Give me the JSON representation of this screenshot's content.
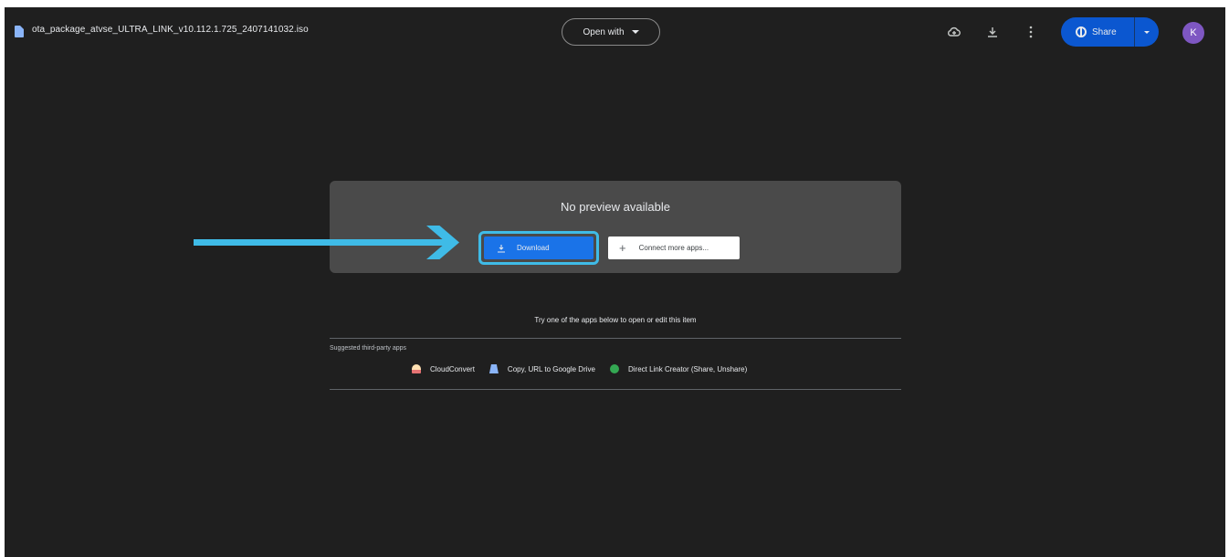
{
  "file": {
    "name": "ota_package_atvse_ULTRA_LINK_v10.112.1.725_2407141032.iso",
    "icon": "file-icon"
  },
  "toolbar": {
    "open_with_label": "Open with",
    "share_label": "Share",
    "avatar_initial": "K",
    "add_shortcut_icon": "add-to-drive-icon",
    "download_icon": "download-icon",
    "more_icon": "more-vert-icon"
  },
  "preview": {
    "title": "No preview available",
    "download_label": "Download",
    "connect_label": "Connect more apps..."
  },
  "apps": {
    "prompt": "Try one of the apps below to open or edit this item",
    "section_label": "Suggested third-party apps",
    "items": [
      {
        "label": "CloudConvert",
        "icon": "cloudconvert-icon"
      },
      {
        "label": "Copy, URL to Google Drive",
        "icon": "drive-icon"
      },
      {
        "label": "Direct Link Creator (Share, Unshare)",
        "icon": "link-icon"
      }
    ]
  },
  "colors": {
    "background": "#1f1f1f",
    "card": "#4a4a4a",
    "primary": "#1a73e8",
    "share": "#0b57d0",
    "highlight": "#3fbbe7",
    "avatar": "#7e57c2"
  }
}
